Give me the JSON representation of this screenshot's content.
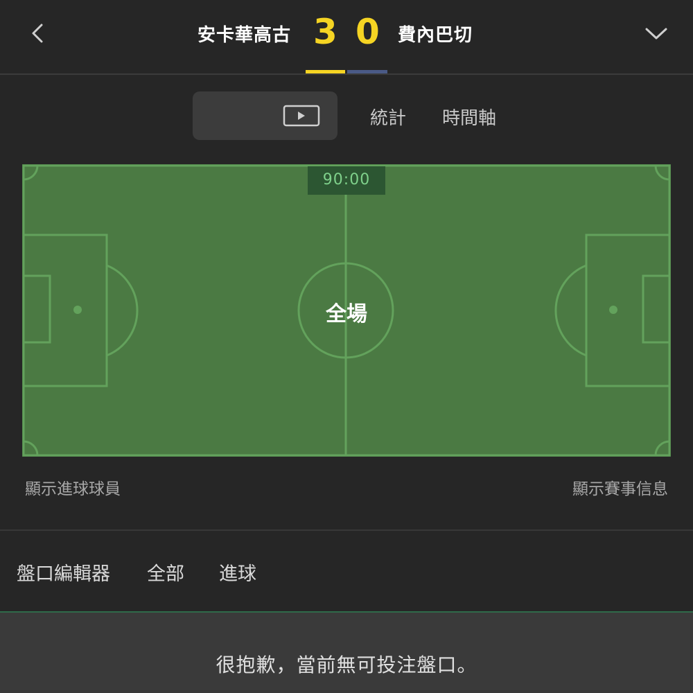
{
  "header": {
    "home_team": "安卡華高古",
    "away_team": "費內巴切",
    "home_score": "3",
    "away_score": "0",
    "home_color": "#f5d423",
    "away_color": "#4a5a86",
    "back_icon": "chevron-left-icon",
    "dropdown_icon": "chevron-down-icon"
  },
  "view_tabs": {
    "pitch_icon": "pitch-icon",
    "video_icon": "play-video-icon",
    "stats": "統計",
    "timeline": "時間軸"
  },
  "pitch": {
    "clock": "90:00",
    "period": "全場"
  },
  "links": {
    "show_scorers": "顯示進球球員",
    "show_match_info": "顯示賽事信息"
  },
  "market_tabs": {
    "editor": "盤口編輯器",
    "all": "全部",
    "goals": "進球"
  },
  "empty_message": "很抱歉，當前無可投注盤口。"
}
